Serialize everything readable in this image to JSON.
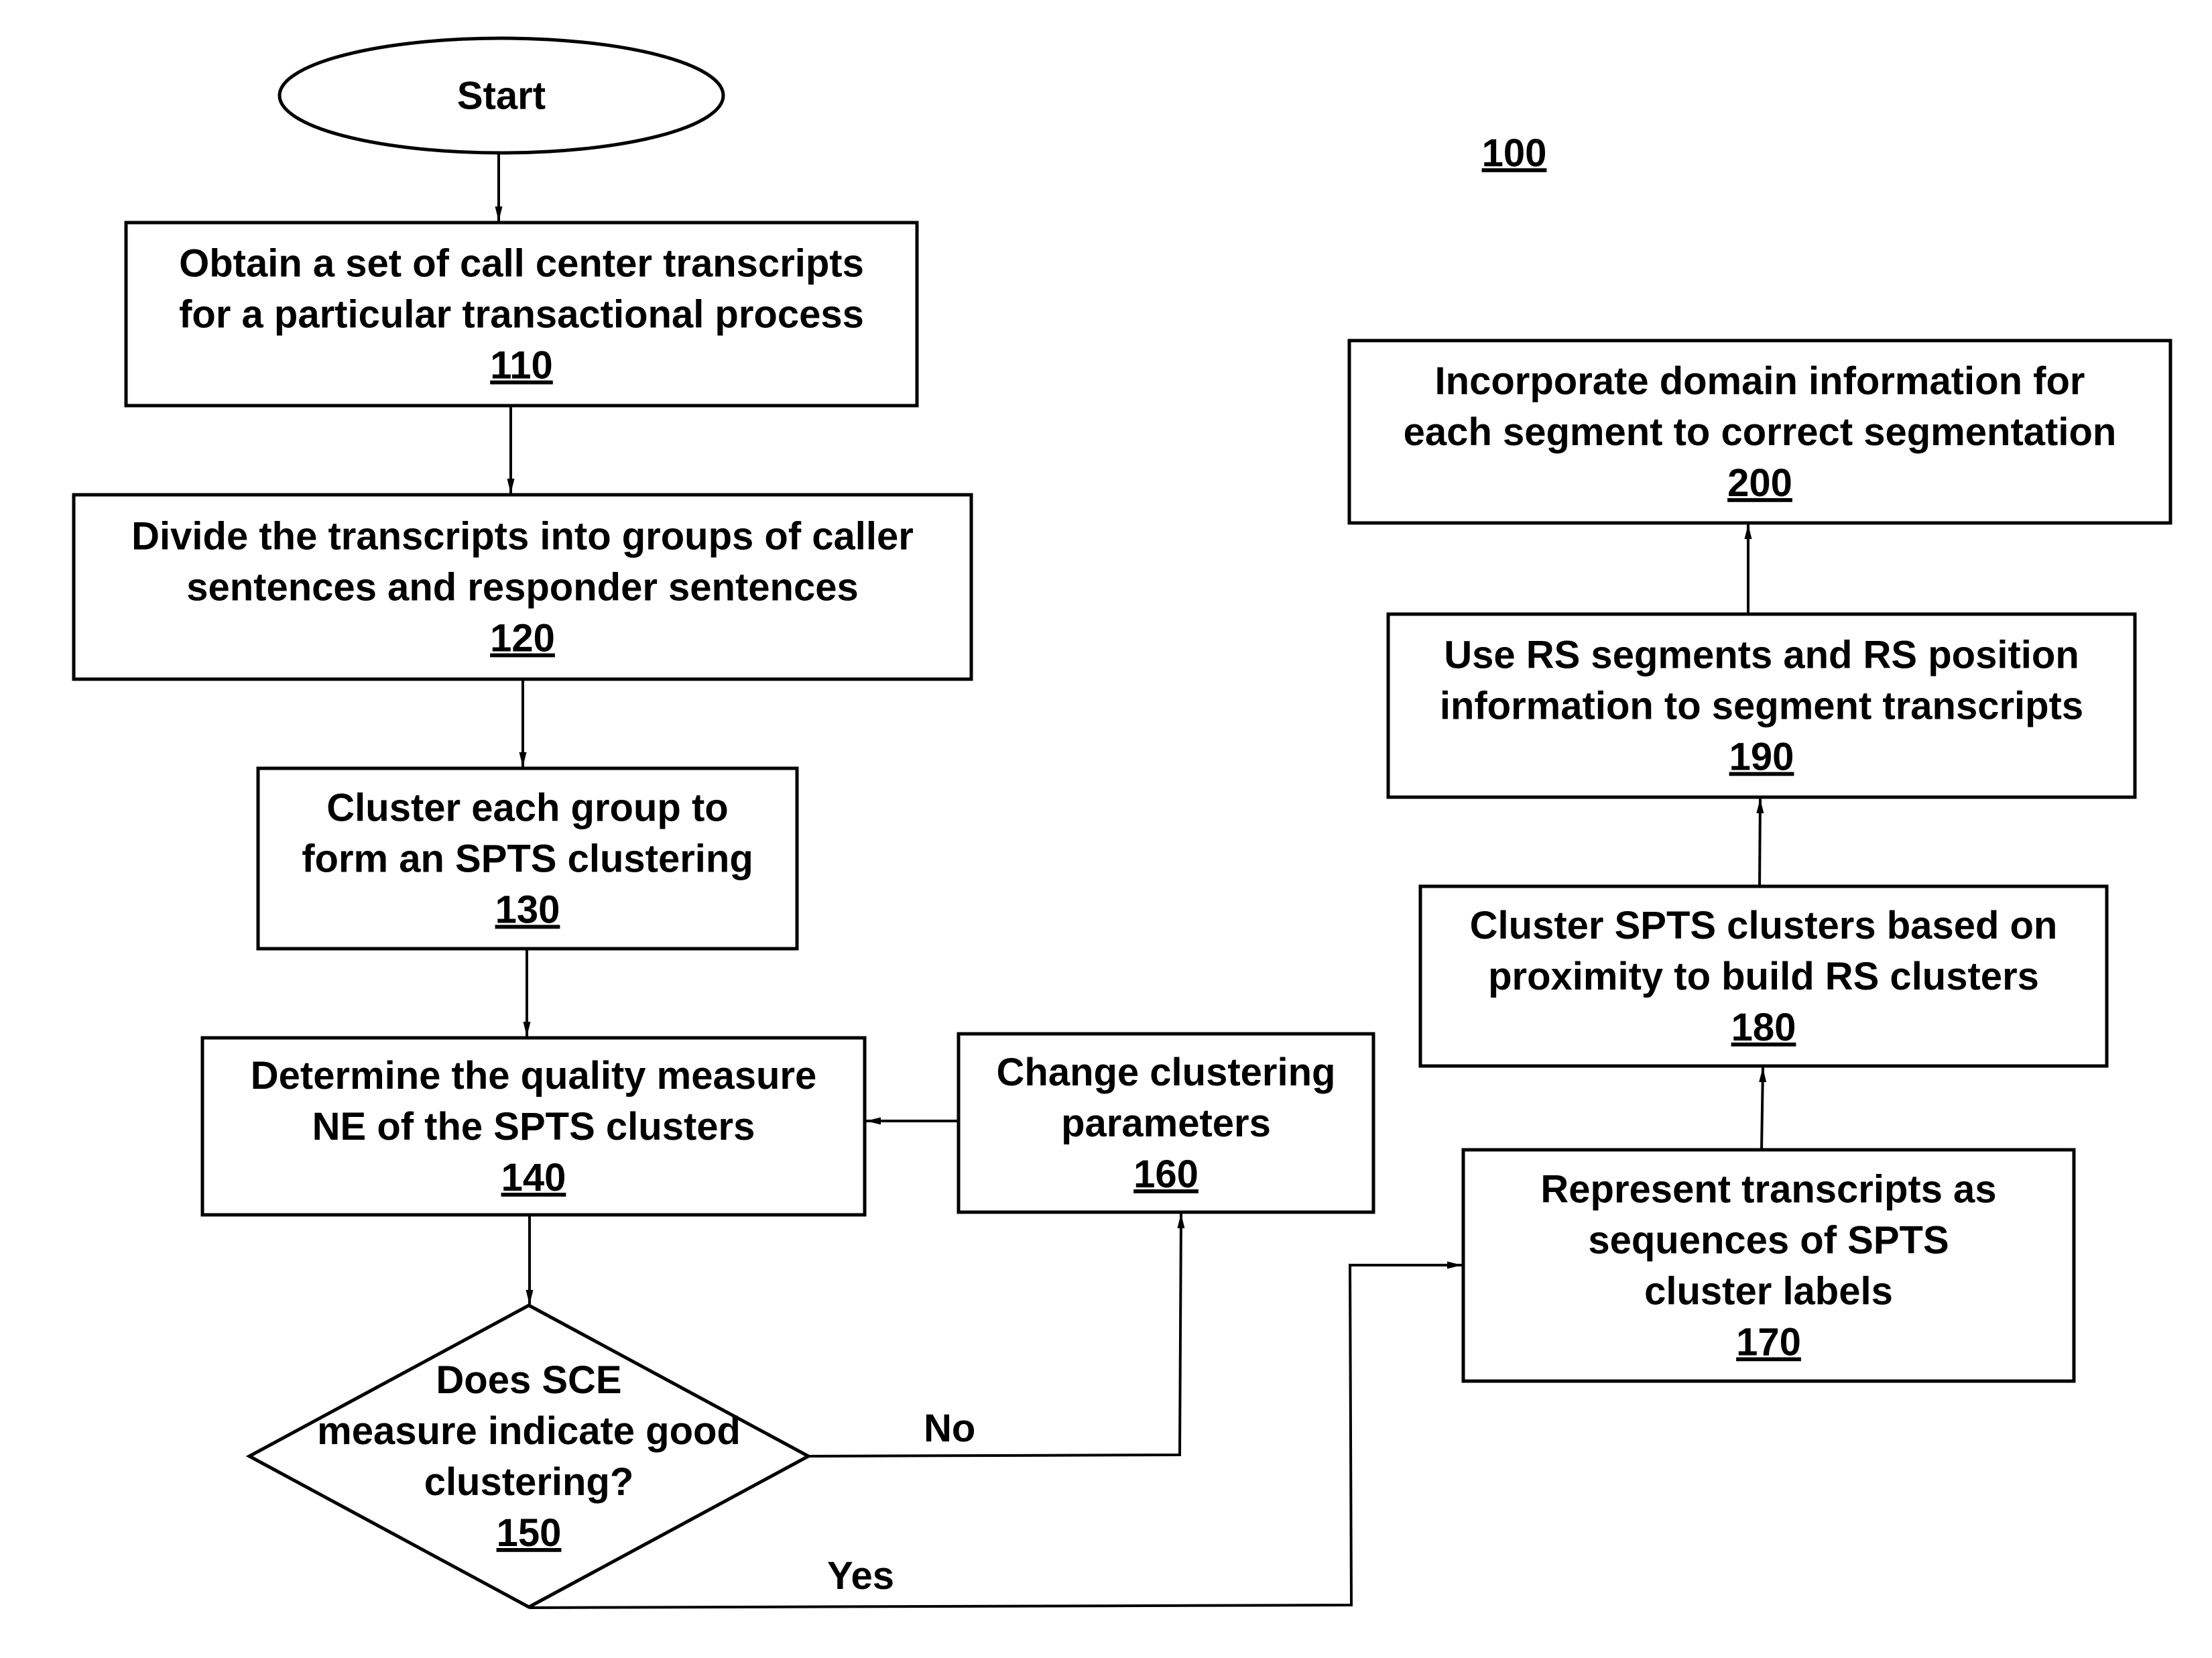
{
  "figure": {
    "reference": "100"
  },
  "nodes": [
    {
      "id": "start",
      "type": "terminal",
      "lines": [
        "Start"
      ],
      "ref": ""
    },
    {
      "id": "110",
      "type": "process",
      "lines": [
        "Obtain a set of call center transcripts",
        "for a particular transactional process"
      ],
      "ref": "110"
    },
    {
      "id": "120",
      "type": "process",
      "lines": [
        "Divide the transcripts into groups of caller",
        "sentences and responder sentences"
      ],
      "ref": "120"
    },
    {
      "id": "130",
      "type": "process",
      "lines": [
        "Cluster each group to",
        "form an SPTS clustering"
      ],
      "ref": "130"
    },
    {
      "id": "140",
      "type": "process",
      "lines": [
        "Determine the quality measure",
        "NE of the SPTS clusters"
      ],
      "ref": "140"
    },
    {
      "id": "150",
      "type": "decision",
      "lines": [
        "Does SCE",
        "measure indicate good",
        "clustering?"
      ],
      "ref": "150"
    },
    {
      "id": "160",
      "type": "process",
      "lines": [
        "Change clustering",
        "parameters"
      ],
      "ref": "160"
    },
    {
      "id": "170",
      "type": "process",
      "lines": [
        "Represent transcripts as",
        "sequences of SPTS",
        "cluster labels"
      ],
      "ref": "170"
    },
    {
      "id": "180",
      "type": "process",
      "lines": [
        "Cluster SPTS clusters based on",
        "proximity to build RS clusters"
      ],
      "ref": "180"
    },
    {
      "id": "190",
      "type": "process",
      "lines": [
        "Use RS segments and RS position",
        "information to segment transcripts"
      ],
      "ref": "190"
    },
    {
      "id": "200",
      "type": "process",
      "lines": [
        "Incorporate domain information for",
        "each segment to correct segmentation"
      ],
      "ref": "200"
    }
  ],
  "edges": [
    {
      "from": "start",
      "to": "110",
      "label": ""
    },
    {
      "from": "110",
      "to": "120",
      "label": ""
    },
    {
      "from": "120",
      "to": "130",
      "label": ""
    },
    {
      "from": "130",
      "to": "140",
      "label": ""
    },
    {
      "from": "140",
      "to": "150",
      "label": ""
    },
    {
      "from": "150",
      "to": "160",
      "label": "No"
    },
    {
      "from": "160",
      "to": "140",
      "label": ""
    },
    {
      "from": "150",
      "to": "170",
      "label": "Yes"
    },
    {
      "from": "170",
      "to": "180",
      "label": ""
    },
    {
      "from": "180",
      "to": "190",
      "label": ""
    },
    {
      "from": "190",
      "to": "200",
      "label": ""
    }
  ]
}
